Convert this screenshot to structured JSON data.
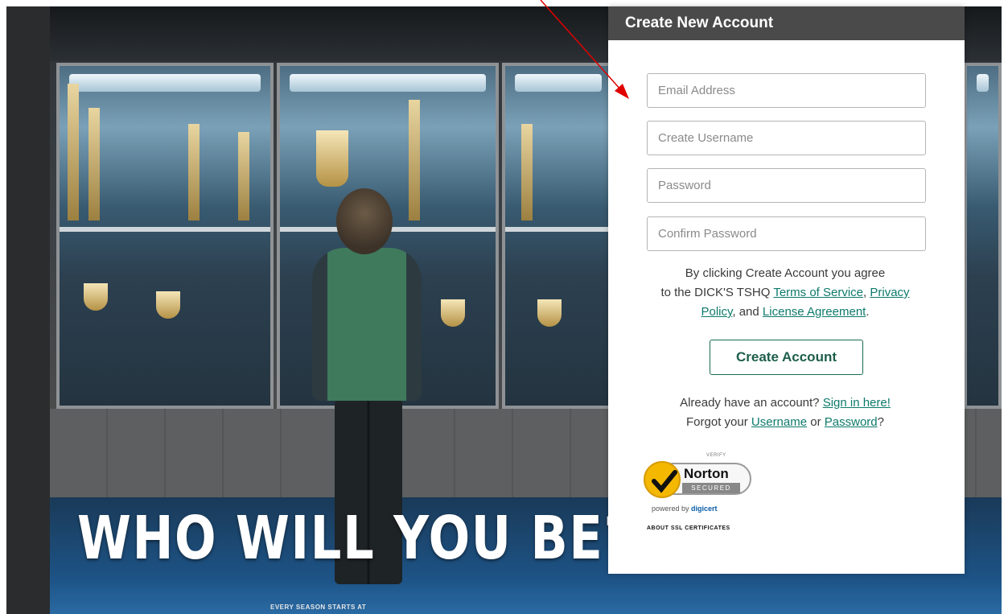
{
  "hero": {
    "slogan": "WHO WILL YOU BE?",
    "tagline": "EVERY SEASON STARTS AT"
  },
  "form": {
    "title": "Create New Account",
    "fields": {
      "email_placeholder": "Email Address",
      "username_placeholder": "Create Username",
      "password_placeholder": "Password",
      "confirm_placeholder": "Confirm Password"
    },
    "legal": {
      "line1": "By clicking Create Account you agree",
      "line2_prefix": "to the DICK'S TSHQ",
      "terms_link": "Terms of Service",
      "sep1": ",",
      "privacy_link_a": "Privacy",
      "privacy_link_b": "Policy",
      "sep2": ", and",
      "license_link": "License Agreement",
      "end": "."
    },
    "create_button": "Create Account",
    "signin": {
      "prefix": "Already have an account?",
      "link": "Sign in here!",
      "forgot_prefix": "Forgot your",
      "username_link": "Username",
      "or": "or",
      "password_link": "Password",
      "end": "?"
    },
    "badge": {
      "verify": "VERIFY",
      "brand": "Norton",
      "secured": "SECURED",
      "powered_by": "powered by",
      "digicert": "digicert",
      "ssl_link": "ABOUT SSL CERTIFICATES"
    }
  },
  "colors": {
    "header_bg": "#4a4a4a",
    "link": "#0d7a6b",
    "button_border": "#1a6b52",
    "annotation_arrow": "#e00000"
  }
}
